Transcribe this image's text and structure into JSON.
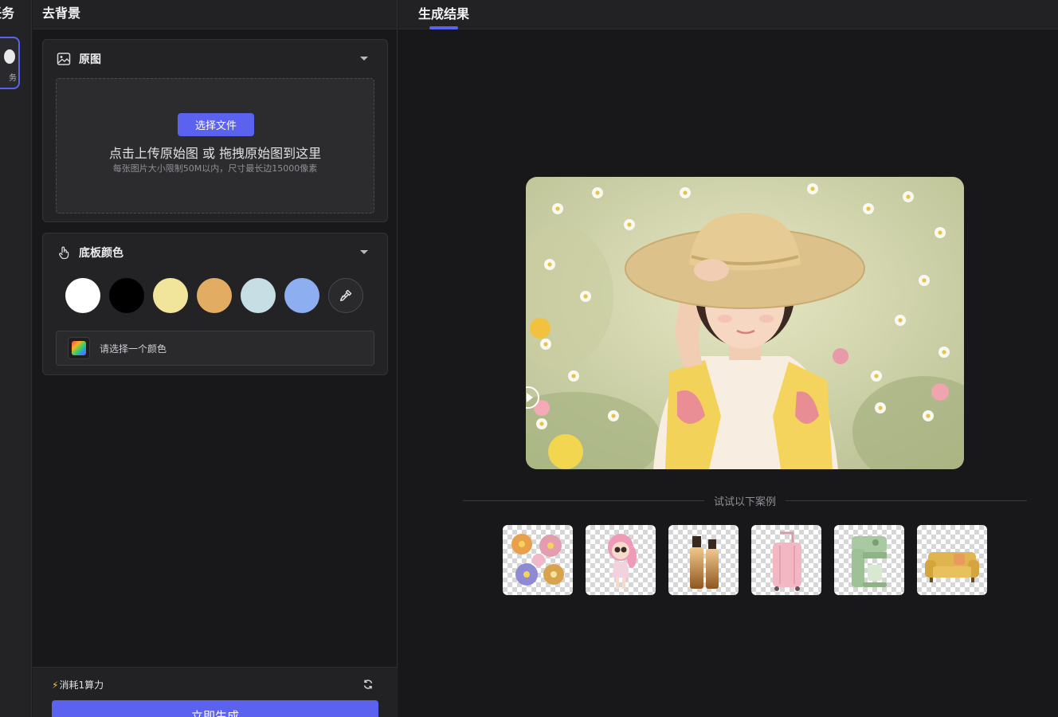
{
  "rail": {
    "title": "任务",
    "card_label": "务",
    "accent": "#5a63f0"
  },
  "panel": {
    "title": "去背景"
  },
  "original": {
    "label": "原图",
    "choose_button": "选择文件",
    "drop_hint": "点击上传原始图 或 拖拽原始图到这里",
    "limit_hint": "每张图片大小限制50M以内，尺寸最长边15000像素"
  },
  "background": {
    "label": "底板颜色",
    "swatches": [
      "#ffffff",
      "#000000",
      "#f1e59c",
      "#e2ad63",
      "#c7dfe4",
      "#8daef0"
    ],
    "picker_icon": "eyedropper-icon",
    "color_placeholder": "请选择一个颜色"
  },
  "footer": {
    "cost": "消耗1算力",
    "generate_button": "立即生成"
  },
  "result": {
    "tab": "生成结果",
    "examples_label": "试试以下案例",
    "examples": [
      "flowers",
      "cartoon-girl",
      "cosmetic-bottles",
      "pink-suitcase",
      "green-coffee-machine",
      "yellow-sofa"
    ]
  },
  "colors": {
    "accent": "#5b62f0",
    "panel_bg": "#232326",
    "page_bg": "#18181a"
  }
}
